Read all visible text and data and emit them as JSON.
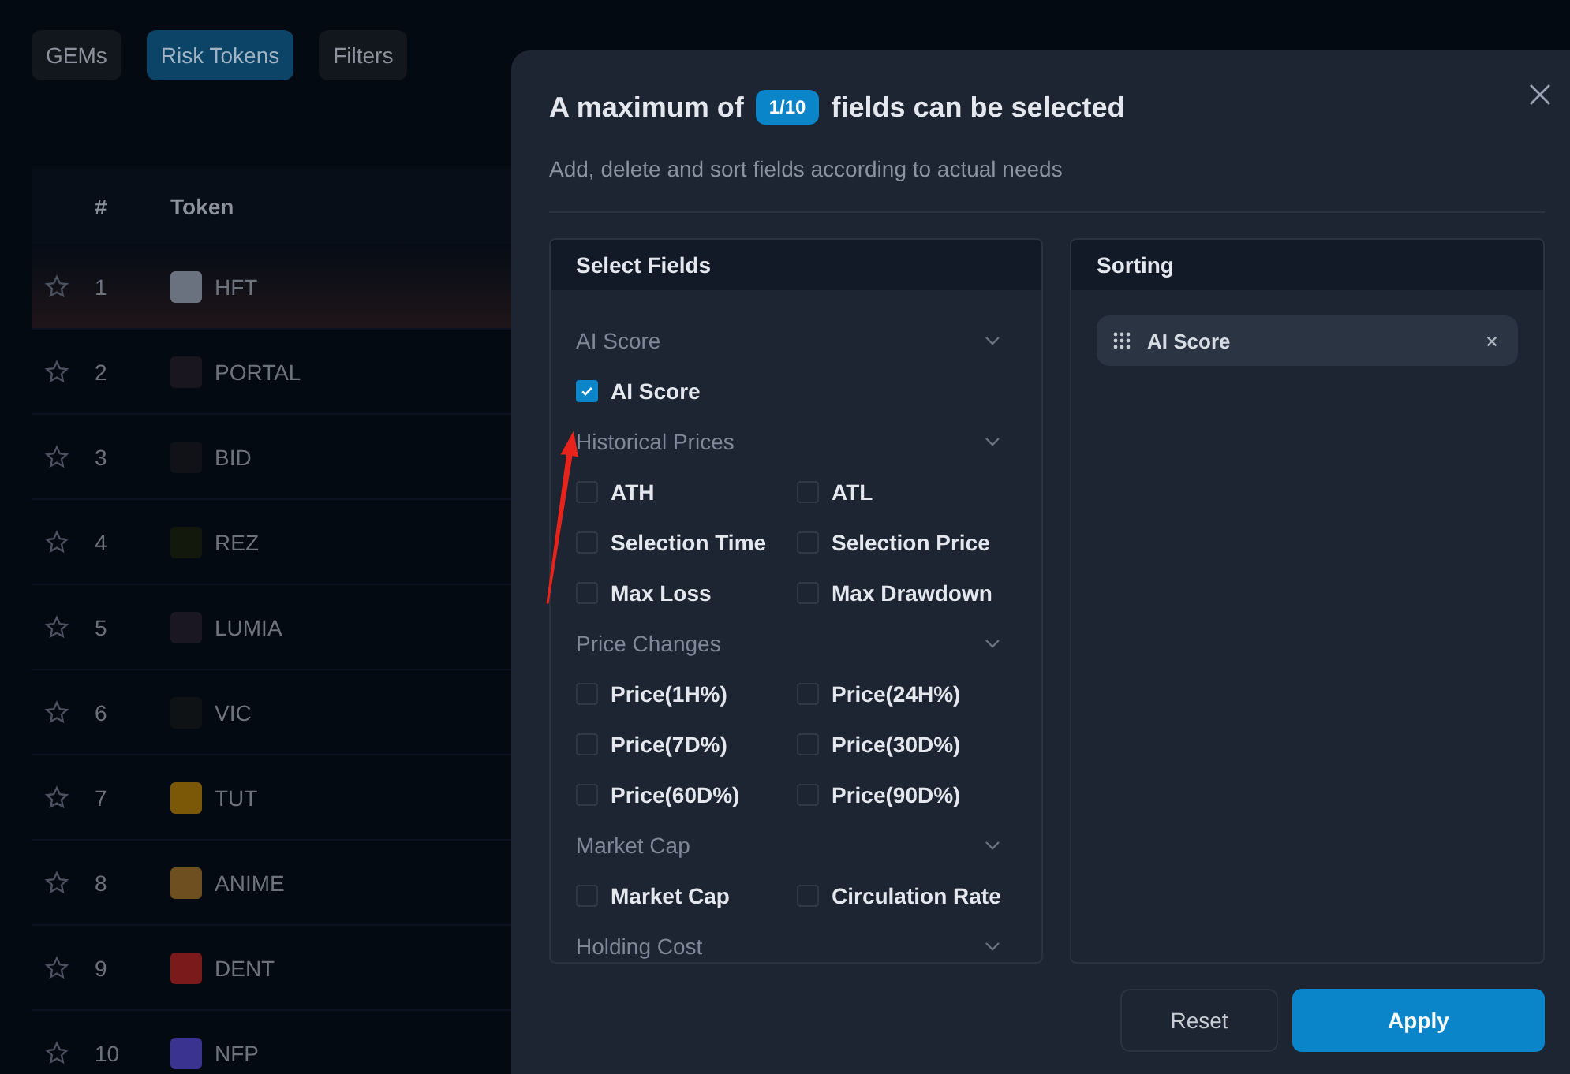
{
  "tabs": [
    {
      "label": "GEMs",
      "selected": false
    },
    {
      "label": "Risk Tokens",
      "selected": true
    },
    {
      "label": "Filters",
      "selected": false
    }
  ],
  "table": {
    "columns": [
      "#",
      "Token"
    ],
    "rows": [
      {
        "rank": "1",
        "token": "HFT",
        "color": "#6a7280",
        "selected": true
      },
      {
        "rank": "2",
        "token": "PORTAL",
        "color": "#1a1620",
        "selected": false
      },
      {
        "rank": "3",
        "token": "BID",
        "color": "#101218",
        "selected": false
      },
      {
        "rank": "4",
        "token": "REZ",
        "color": "#12180c",
        "selected": false
      },
      {
        "rank": "5",
        "token": "LUMIA",
        "color": "#1a1622",
        "selected": false
      },
      {
        "rank": "6",
        "token": "VIC",
        "color": "#0e1214",
        "selected": false
      },
      {
        "rank": "7",
        "token": "TUT",
        "color": "#7a5808",
        "selected": false
      },
      {
        "rank": "8",
        "token": "ANIME",
        "color": "#6e5020",
        "selected": false
      },
      {
        "rank": "9",
        "token": "DENT",
        "color": "#7a1a1a",
        "selected": false
      },
      {
        "rank": "10",
        "token": "NFP",
        "color": "#3a3490",
        "selected": false
      }
    ]
  },
  "dialog": {
    "title_prefix": "A maximum of",
    "count": "1/10",
    "title_suffix": "fields can be selected",
    "subtitle": "Add, delete and sort fields according to actual needs",
    "select_fields": {
      "title": "Select Fields",
      "groups": [
        {
          "title": "AI Score",
          "expanded": true,
          "options": [
            {
              "label": "AI Score",
              "checked": true
            }
          ]
        },
        {
          "title": "Historical Prices",
          "expanded": true,
          "options": [
            {
              "label": "ATH",
              "checked": false
            },
            {
              "label": "ATL",
              "checked": false
            },
            {
              "label": "Selection Time",
              "checked": false
            },
            {
              "label": "Selection Price",
              "checked": false
            },
            {
              "label": "Max Loss",
              "checked": false
            },
            {
              "label": "Max Drawdown",
              "checked": false
            }
          ]
        },
        {
          "title": "Price Changes",
          "expanded": true,
          "options": [
            {
              "label": "Price(1H%)",
              "checked": false
            },
            {
              "label": "Price(24H%)",
              "checked": false
            },
            {
              "label": "Price(7D%)",
              "checked": false
            },
            {
              "label": "Price(30D%)",
              "checked": false
            },
            {
              "label": "Price(60D%)",
              "checked": false
            },
            {
              "label": "Price(90D%)",
              "checked": false
            }
          ]
        },
        {
          "title": "Market Cap",
          "expanded": true,
          "options": [
            {
              "label": "Market Cap",
              "checked": false
            },
            {
              "label": "Circulation Rate",
              "checked": false
            }
          ]
        },
        {
          "title": "Holding Cost",
          "expanded": true
        }
      ]
    },
    "sorting": {
      "title": "Sorting",
      "items": [
        {
          "label": "AI Score"
        }
      ]
    },
    "buttons": [
      {
        "label": "Reset",
        "kind": "secondary"
      },
      {
        "label": "Apply",
        "kind": "primary"
      }
    ]
  }
}
